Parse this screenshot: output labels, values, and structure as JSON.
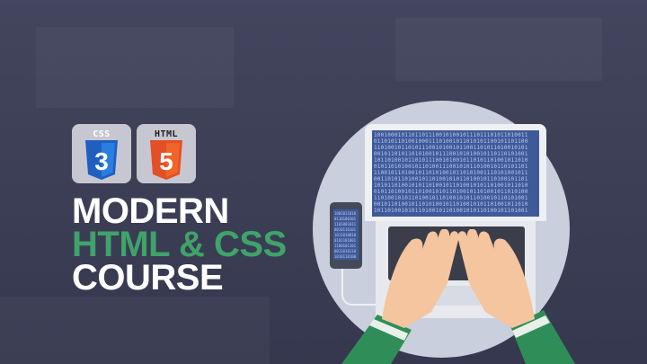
{
  "badges": {
    "css_label": "CSS",
    "css_digit": "3",
    "html_label": "HTML",
    "html_digit": "5"
  },
  "title": {
    "line1": "MODERN",
    "line2": "HTML & CSS",
    "line3": "COURSE"
  },
  "colors": {
    "background": "#3b3e57",
    "accent_green": "#3fa36a",
    "css_blue": "#2a6fd6",
    "html_orange": "#e4532b",
    "screen_blue": "#3f5a99"
  },
  "icons": [
    "css3-shield-icon",
    "html5-shield-icon",
    "laptop-icon",
    "smartphone-icon",
    "hands-icon"
  ]
}
